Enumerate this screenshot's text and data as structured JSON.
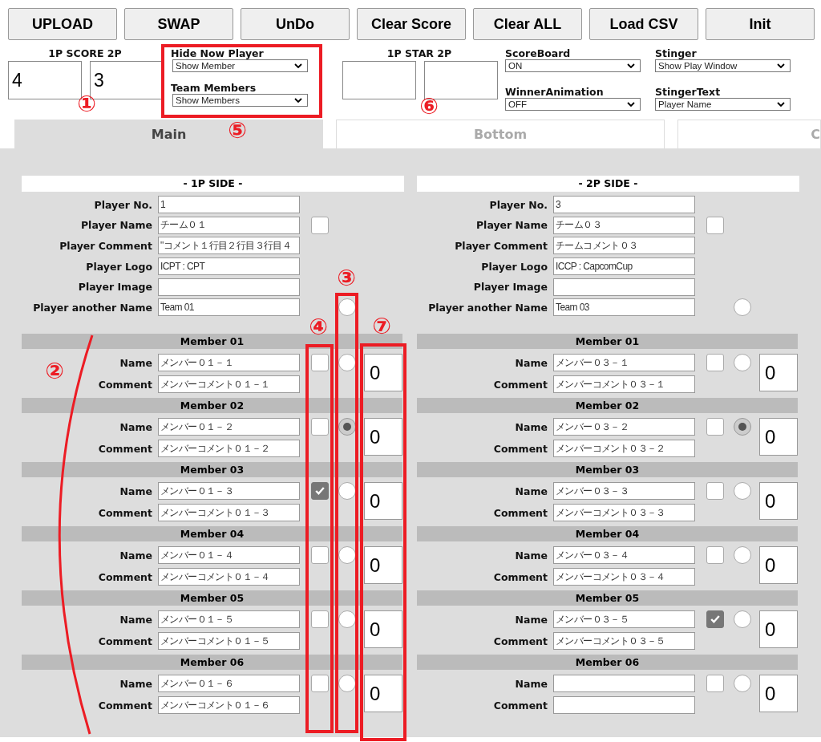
{
  "toolbar": [
    {
      "label": "UPLOAD"
    },
    {
      "label": "SWAP"
    },
    {
      "label": "UnDo"
    },
    {
      "label": "Clear Score"
    },
    {
      "label": "Clear ALL"
    },
    {
      "label": "Load CSV"
    },
    {
      "label": "Init"
    }
  ],
  "score": {
    "label": "1P SCORE 2P",
    "p1": "4",
    "p2": "3"
  },
  "view_selects": [
    {
      "label": "Hide Now Player",
      "value": "Show Member"
    },
    {
      "label": "Team Members",
      "value": "Show Members"
    }
  ],
  "star": {
    "label": "1P STAR 2P"
  },
  "option_selects": [
    {
      "label": "ScoreBoard",
      "value": "ON"
    },
    {
      "label": "Stinger",
      "value": "Show Play Window"
    },
    {
      "label": "WinnerAnimation",
      "value": "OFF"
    },
    {
      "label": "StingerText",
      "value": "Player Name"
    }
  ],
  "tabs": [
    {
      "label": "Main",
      "selected": true
    },
    {
      "label": "Bottom",
      "selected": false
    },
    {
      "label": "C",
      "selected": false
    }
  ],
  "sides": [
    {
      "title": "- 1P SIDE -",
      "fields": [
        {
          "kind": "text",
          "label": "Player No.",
          "value": "1"
        },
        {
          "kind": "checkbox",
          "label": "Player Name",
          "value": "チーム０１",
          "checked": false
        },
        {
          "kind": "text",
          "label": "Player Comment",
          "value": "\"コメント１行目２行目３行目４"
        },
        {
          "kind": "text",
          "label": "Player Logo",
          "value": "ICPT : CPT"
        },
        {
          "kind": "text",
          "label": "Player Image"
        },
        {
          "kind": "radio",
          "label": "Player another Name",
          "value": "Team 01",
          "selected": false
        }
      ],
      "members": [
        {
          "title": "Member 01",
          "name_label": "Name",
          "name": "メンバー０１－１",
          "comment_label": "Comment",
          "comment": "メンバーコメント０１－１",
          "checked": false,
          "selected": false,
          "count": "0"
        },
        {
          "title": "Member 02",
          "name_label": "Name",
          "name": "メンバー０１－２",
          "comment_label": "Comment",
          "comment": "メンバーコメント０１－２",
          "checked": false,
          "selected": true,
          "count": "0"
        },
        {
          "title": "Member 03",
          "name_label": "Name",
          "name": "メンバー０１－３",
          "comment_label": "Comment",
          "comment": "メンバーコメント０１－３",
          "checked": true,
          "selected": false,
          "count": "0"
        },
        {
          "title": "Member 04",
          "name_label": "Name",
          "name": "メンバー０１－４",
          "comment_label": "Comment",
          "comment": "メンバーコメント０１－４",
          "checked": false,
          "selected": false,
          "count": "0"
        },
        {
          "title": "Member 05",
          "name_label": "Name",
          "name": "メンバー０１－５",
          "comment_label": "Comment",
          "comment": "メンバーコメント０１－５",
          "checked": false,
          "selected": false,
          "count": "0"
        },
        {
          "title": "Member 06",
          "name_label": "Name",
          "name": "メンバー０１－６",
          "comment_label": "Comment",
          "comment": "メンバーコメント０１－６",
          "checked": false,
          "selected": false,
          "count": "0"
        }
      ]
    },
    {
      "title": "- 2P SIDE -",
      "fields": [
        {
          "kind": "text",
          "label": "Player No.",
          "value": "3"
        },
        {
          "kind": "checkbox",
          "label": "Player Name",
          "value": "チーム０３",
          "checked": false
        },
        {
          "kind": "text",
          "label": "Player Comment",
          "value": "チームコメント０３"
        },
        {
          "kind": "text",
          "label": "Player Logo",
          "value": "ICCP : CapcomCup"
        },
        {
          "kind": "text",
          "label": "Player Image"
        },
        {
          "kind": "radio",
          "label": "Player another Name",
          "value": "Team 03",
          "selected": false
        }
      ],
      "members": [
        {
          "title": "Member 01",
          "name_label": "Name",
          "name": "メンバー０３－１",
          "comment_label": "Comment",
          "comment": "メンバーコメント０３－１",
          "checked": false,
          "selected": false,
          "count": "0"
        },
        {
          "title": "Member 02",
          "name_label": "Name",
          "name": "メンバー０３－２",
          "comment_label": "Comment",
          "comment": "メンバーコメント０３－２",
          "checked": false,
          "selected": true,
          "count": "0"
        },
        {
          "title": "Member 03",
          "name_label": "Name",
          "name": "メンバー０３－３",
          "comment_label": "Comment",
          "comment": "メンバーコメント０３－３",
          "checked": false,
          "selected": false,
          "count": "0"
        },
        {
          "title": "Member 04",
          "name_label": "Name",
          "name": "メンバー０３－４",
          "comment_label": "Comment",
          "comment": "メンバーコメント０３－４",
          "checked": false,
          "selected": false,
          "count": "0"
        },
        {
          "title": "Member 05",
          "name_label": "Name",
          "name": "メンバー０３－５",
          "comment_label": "Comment",
          "comment": "メンバーコメント０３－５",
          "checked": true,
          "selected": false,
          "count": "0"
        },
        {
          "title": "Member 06",
          "name_label": "Name",
          "comment_label": "Comment",
          "checked": false,
          "selected": false,
          "count": "0"
        }
      ]
    }
  ],
  "callouts": [
    {
      "text": "①"
    },
    {
      "text": "②"
    },
    {
      "text": "③"
    },
    {
      "text": "④"
    },
    {
      "text": "⑤"
    },
    {
      "text": "⑥"
    },
    {
      "text": "⑦"
    }
  ]
}
